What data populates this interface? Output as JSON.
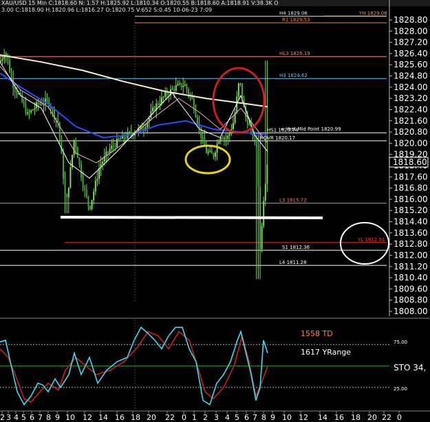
{
  "header": {
    "text": "XAU/USD 15 Min  C:1818.60  N: 1.57  H:1825.92  L:1810.34  O:1820.55  B:1818.60  A:1818.91  V:38.3K  O",
    "sub": "3.00  C:1818.90  H:1820.96  L:1816.27  O:1820.75  V:652  S:0.45  10-06-23  7:09"
  },
  "chart_data": {
    "type": "candlestick",
    "price_axis": {
      "ylim": [
        1807.5,
        1829.5
      ],
      "ticks": [
        "1828.80",
        "1828.00",
        "1827.20",
        "1826.40",
        "1825.60",
        "1824.80",
        "1824.00",
        "1823.20",
        "1822.40",
        "1821.60",
        "1820.80",
        "1820.00",
        "1819.20",
        "1818.40",
        "1817.60",
        "1816.80",
        "1816.00",
        "1815.20",
        "1814.40",
        "1813.60",
        "1812.80",
        "1812.00",
        "1811.20",
        "1810.40",
        "1809.60",
        "1808.80",
        "1808.00"
      ],
      "current_price": "1818.60"
    },
    "time_axis": {
      "labels": [
        "2",
        "3",
        "4",
        "5",
        "6",
        "7",
        "8",
        "9",
        "10",
        "12",
        "14",
        "16",
        "18",
        "20",
        "22",
        "0",
        "1",
        "2",
        "3",
        "4",
        "5",
        "6",
        "7",
        "8",
        "9",
        "10",
        "12",
        "14",
        "16",
        "18",
        "20",
        "22",
        "0"
      ]
    },
    "levels": [
      {
        "label": "H4 1829.06",
        "value": 1829.06,
        "color": "#e8e8e8"
      },
      {
        "label": "YH 1829.08",
        "value": 1829.08,
        "color": "#e0a060"
      },
      {
        "label": "R1 1829.53",
        "value": 1828.6,
        "color": "#ff8040"
      },
      {
        "label": "HL3 1826.19",
        "value": 1826.19,
        "color": "#ff8060"
      },
      {
        "label": "H3 1824.62",
        "value": 1824.62,
        "color": "#60c0ff"
      },
      {
        "label": "HS1 1820.74",
        "value": 1820.74,
        "color": "#ffffff"
      },
      {
        "label": "ROVR 1820.17",
        "value": 1820.17,
        "color": "#ffffff"
      },
      {
        "label": "L3 1815.72",
        "value": 1815.72,
        "color": "#ff8060"
      },
      {
        "label": "S1 1812.36",
        "value": 1812.36,
        "color": "#ffffff"
      },
      {
        "label": "YL 1812.91",
        "value": 1812.91,
        "color": "#ff3030"
      },
      {
        "label": "L4 1811.28",
        "value": 1811.28,
        "color": "#ffffff"
      }
    ],
    "annotations": [
      "← Yest Mid Point 1820.99",
      "1558 TD",
      "1617 YRange"
    ],
    "oscillator": {
      "label": "STO  34,",
      "levels": [
        "75.00",
        "25.00"
      ]
    }
  }
}
